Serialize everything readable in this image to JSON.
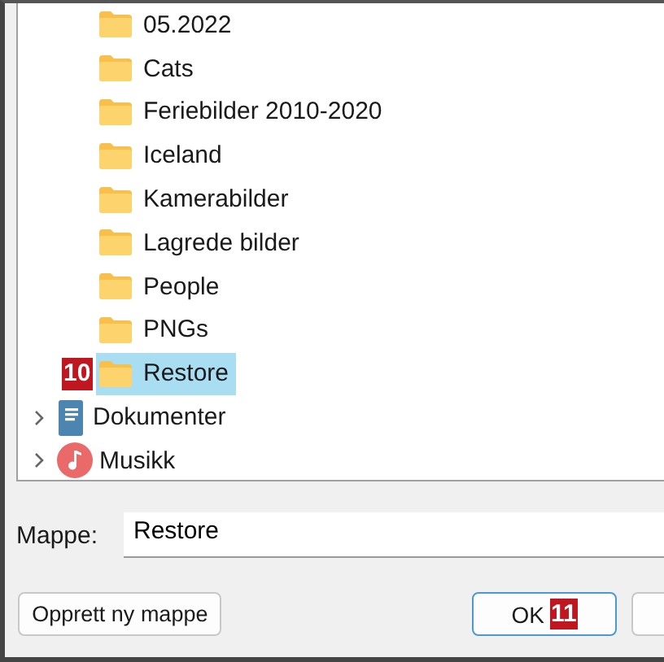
{
  "tree": {
    "subfolders": [
      {
        "label": "05.2022",
        "selected": false
      },
      {
        "label": "Cats",
        "selected": false
      },
      {
        "label": "Feriebilder 2010-2020",
        "selected": false
      },
      {
        "label": "Iceland",
        "selected": false
      },
      {
        "label": "Kamerabilder",
        "selected": false
      },
      {
        "label": "Lagrede bilder",
        "selected": false
      },
      {
        "label": "People",
        "selected": false
      },
      {
        "label": "PNGs",
        "selected": false
      },
      {
        "label": "Restore",
        "selected": true,
        "badge": "10"
      }
    ],
    "libraries": [
      {
        "label": "Dokumenter",
        "kind": "documents",
        "expanded": false
      },
      {
        "label": "Musikk",
        "kind": "music",
        "expanded": false
      }
    ]
  },
  "folder_field": {
    "label": "Mappe:",
    "value": "Restore"
  },
  "buttons": [
    {
      "label": "Opprett ny mappe",
      "kind": "secondary"
    },
    {
      "label": "OK",
      "kind": "default",
      "badge": "11"
    },
    {
      "kind": "cut"
    }
  ]
}
